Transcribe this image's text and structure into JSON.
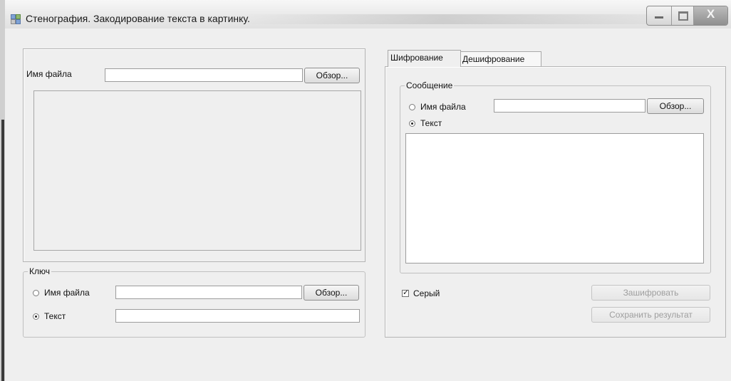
{
  "window": {
    "title": "Стенография. Закодирование текста в картинку.",
    "controls": [
      "minimize-icon",
      "maximize-icon",
      "close-icon"
    ],
    "close_glyph": "X"
  },
  "image_panel": {
    "filename_label": "Имя файла",
    "filename_value": "",
    "browse_label": "Обзор..."
  },
  "key_group": {
    "title": "Ключ",
    "radio_file_label": "Имя файла",
    "radio_file_checked": false,
    "file_value": "",
    "browse_label": "Обзор...",
    "radio_text_label": "Текст",
    "radio_text_checked": true,
    "text_value": ""
  },
  "tabs": [
    {
      "label": "Шифрование",
      "active": true
    },
    {
      "label": "Дешифрование",
      "active": false
    }
  ],
  "message_group": {
    "title": "Сообщение",
    "radio_file_label": "Имя файла",
    "radio_file_checked": false,
    "file_value": "",
    "browse_label": "Обзор...",
    "radio_text_label": "Текст",
    "radio_text_checked": true,
    "text_value": ""
  },
  "options": {
    "grey_label": "Серый",
    "grey_checked": true
  },
  "actions": {
    "encrypt_label": "Зашифровать",
    "save_label": "Сохранить результат"
  }
}
